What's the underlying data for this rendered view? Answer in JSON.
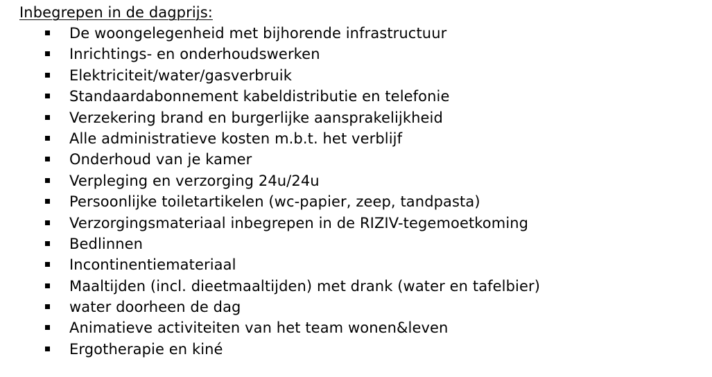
{
  "document": {
    "heading": "Inbegrepen in de dagprijs:",
    "items": [
      "De woongelegenheid met bijhorende infrastructuur",
      "Inrichtings- en onderhoudswerken",
      "Elektriciteit/water/gasverbruik",
      "Standaardabonnement kabeldistributie en telefonie",
      "Verzekering brand en burgerlijke aansprakelijkheid",
      "Alle administratieve kosten m.b.t. het verblijf",
      "Onderhoud van je kamer",
      "Verpleging en verzorging 24u/24u",
      "Persoonlijke toiletartikelen (wc-papier, zeep, tandpasta)",
      "Verzorgingsmateriaal inbegrepen in de RIZIV-tegemoetkoming",
      "Bedlinnen",
      "Incontinentiemateriaal",
      "Maaltijden (incl. dieetmaaltijden) met drank (water en tafelbier)",
      "water doorheen de dag",
      "Animatieve activiteiten van het team wonen&leven",
      "Ergotherapie en kiné"
    ]
  }
}
